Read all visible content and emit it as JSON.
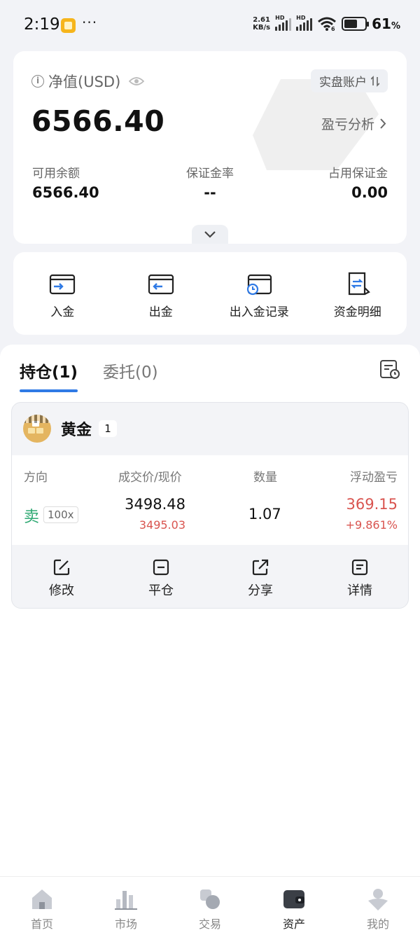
{
  "status_bar": {
    "time": "2:19",
    "dots": "···",
    "net_speed_value": "2.61",
    "net_speed_unit": "KB/s",
    "signal_label_1": "HD",
    "signal_label_2": "HD",
    "wifi_label": "6",
    "battery_pct": "61",
    "battery_unit": "%"
  },
  "equity": {
    "label": "净值(USD)",
    "value": "6566.40",
    "account_switch": "实盘账户",
    "pnl_analysis": "盈亏分析",
    "stats": [
      {
        "label": "可用余额",
        "value": "6566.40"
      },
      {
        "label": "保证金率",
        "value": "--"
      },
      {
        "label": "占用保证金",
        "value": "0.00"
      }
    ]
  },
  "quick_actions": [
    {
      "label": "入金",
      "icon": "deposit-icon"
    },
    {
      "label": "出金",
      "icon": "withdraw-icon"
    },
    {
      "label": "出入金记录",
      "icon": "funds-record-icon"
    },
    {
      "label": "资金明细",
      "icon": "fund-detail-icon"
    }
  ],
  "tabs": [
    {
      "label": "持仓(1)",
      "active": true
    },
    {
      "label": "委托(0)",
      "active": false
    }
  ],
  "position": {
    "symbol": "黄金",
    "count": "1",
    "columns": {
      "direction": "方向",
      "price": "成交价/现价",
      "quantity": "数量",
      "pnl": "浮动盈亏"
    },
    "side": "卖",
    "leverage": "100x",
    "open_price": "3498.48",
    "current_price": "3495.03",
    "quantity": "1.07",
    "pnl": "369.15",
    "pnl_pct": "+9.861%",
    "actions": [
      {
        "label": "修改",
        "icon": "edit-icon"
      },
      {
        "label": "平仓",
        "icon": "close-position-icon"
      },
      {
        "label": "分享",
        "icon": "share-icon"
      },
      {
        "label": "详情",
        "icon": "details-icon"
      }
    ]
  },
  "bottom_nav": [
    {
      "label": "首页",
      "icon": "home-icon",
      "active": false
    },
    {
      "label": "市场",
      "icon": "market-icon",
      "active": false
    },
    {
      "label": "交易",
      "icon": "trade-icon",
      "active": false
    },
    {
      "label": "资产",
      "icon": "wallet-icon",
      "active": true
    },
    {
      "label": "我的",
      "icon": "profile-icon",
      "active": false
    }
  ],
  "colors": {
    "accent": "#2f7ae5",
    "sell_green": "#2ea872",
    "profit_red": "#d9544f"
  }
}
